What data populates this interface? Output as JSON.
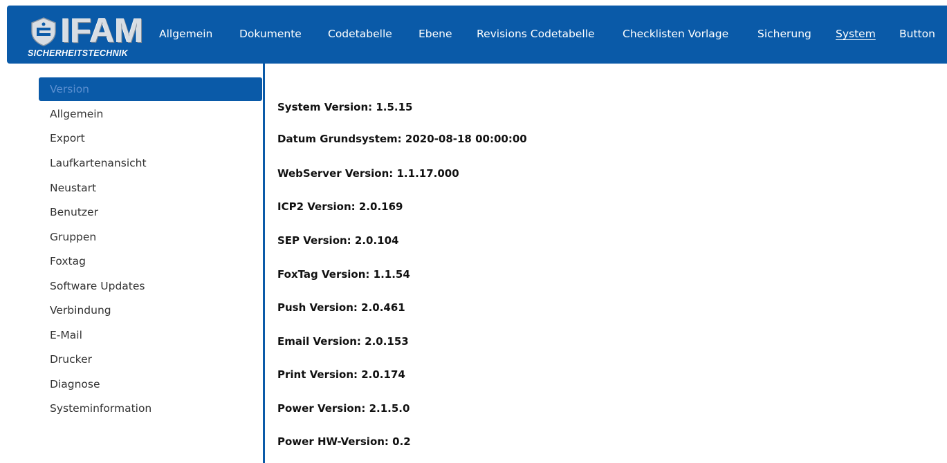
{
  "logo": {
    "brand": "IFAM",
    "tagline": "SICHERHEITSTECHNIK"
  },
  "nav": {
    "items": [
      {
        "label": "Allgemein"
      },
      {
        "label": "Dokumente"
      },
      {
        "label": "Codetabelle"
      },
      {
        "label": "Ebene"
      },
      {
        "label": "Revisions Codetabelle"
      },
      {
        "label": "Checklisten Vorlage"
      },
      {
        "label": "Sicherung"
      },
      {
        "label": "System"
      },
      {
        "label": "Button"
      }
    ],
    "active": "System"
  },
  "sidebar": {
    "items": [
      {
        "label": "Version"
      },
      {
        "label": "Allgemein"
      },
      {
        "label": "Export"
      },
      {
        "label": "Laufkartenansicht"
      },
      {
        "label": "Neustart"
      },
      {
        "label": "Benutzer"
      },
      {
        "label": "Gruppen"
      },
      {
        "label": "Foxtag"
      },
      {
        "label": "Software Updates"
      },
      {
        "label": "Verbindung"
      },
      {
        "label": "E-Mail"
      },
      {
        "label": "Drucker"
      },
      {
        "label": "Diagnose"
      },
      {
        "label": "Systeminformation"
      }
    ],
    "active": "Version"
  },
  "main": {
    "lines": [
      {
        "text": "System Version: 1.5.15"
      },
      {
        "text": "Datum Grundsystem: 2020-08-18 00:00:00"
      },
      {
        "text": "WebServer Version: 1.1.17.000"
      },
      {
        "text": "ICP2 Version: 2.0.169"
      },
      {
        "text": "SEP Version: 2.0.104"
      },
      {
        "text": "FoxTag Version: 1.1.54"
      },
      {
        "text": "Push Version: 2.0.461"
      },
      {
        "text": "Email Version: 2.0.153"
      },
      {
        "text": "Print Version: 2.0.174"
      },
      {
        "text": "Power Version: 2.1.5.0"
      },
      {
        "text": "Power HW-Version: 0.2"
      }
    ]
  },
  "colors": {
    "brand": "#0a5aa8",
    "nav_text": "#ffffff",
    "active_sidebar_text": "#5b8fd0"
  }
}
